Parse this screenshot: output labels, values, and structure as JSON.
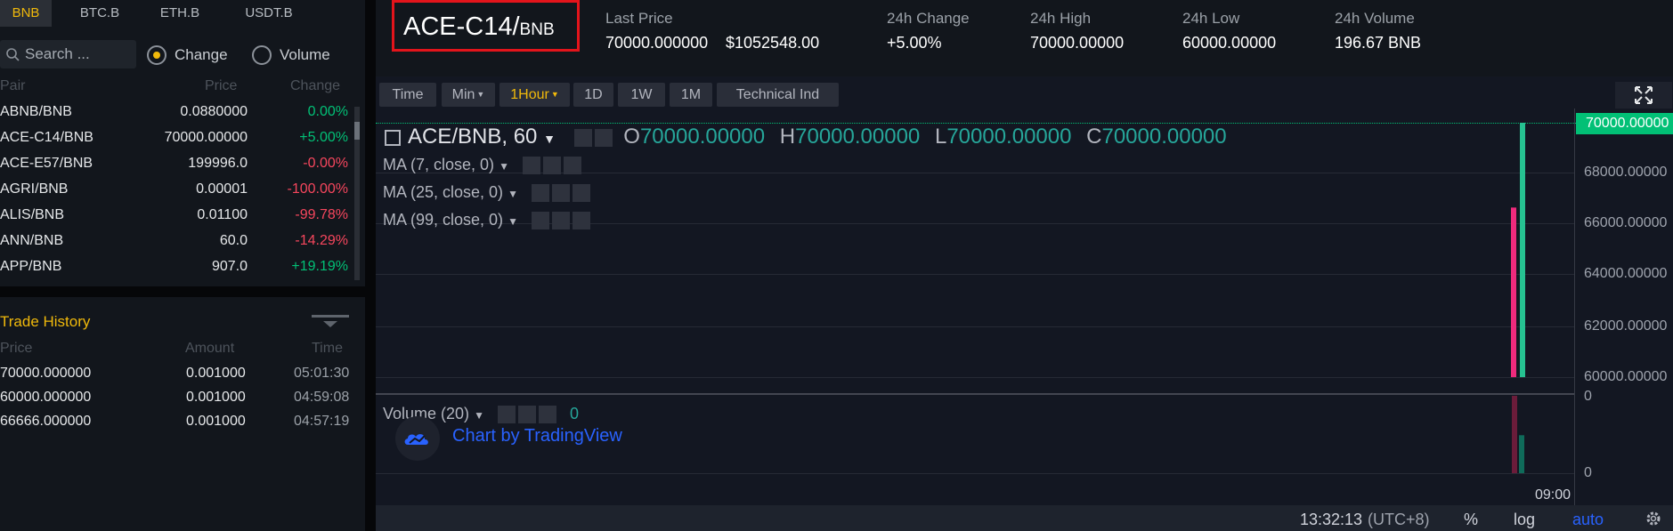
{
  "quote_tabs": [
    {
      "label": "BNB",
      "active": true
    },
    {
      "label": "BTC.B",
      "active": false
    },
    {
      "label": "ETH.B",
      "active": false
    },
    {
      "label": "USDT.B",
      "active": false
    }
  ],
  "search": {
    "placeholder": "Search ..."
  },
  "sort_options": [
    {
      "label": "Change",
      "checked": true
    },
    {
      "label": "Volume",
      "checked": false
    }
  ],
  "pair_table": {
    "headers": {
      "pair": "Pair",
      "price": "Price",
      "change": "Change"
    },
    "rows": [
      {
        "pair": "ABNB/BNB",
        "price": "0.0880000",
        "change": "0.00%",
        "dir": "up"
      },
      {
        "pair": "ACE-C14/BNB",
        "price": "70000.00000",
        "change": "+5.00%",
        "dir": "up"
      },
      {
        "pair": "ACE-E57/BNB",
        "price": "199996.0",
        "change": "-0.00%",
        "dir": "down"
      },
      {
        "pair": "AGRI/BNB",
        "price": "0.00001",
        "change": "-100.00%",
        "dir": "down"
      },
      {
        "pair": "ALIS/BNB",
        "price": "0.01100",
        "change": "-99.78%",
        "dir": "down"
      },
      {
        "pair": "ANN/BNB",
        "price": "60.0",
        "change": "-14.29%",
        "dir": "down"
      },
      {
        "pair": "APP/BNB",
        "price": "907.0",
        "change": "+19.19%",
        "dir": "up"
      }
    ]
  },
  "trade_history": {
    "title": "Trade History",
    "headers": {
      "price": "Price",
      "amount": "Amount",
      "time": "Time"
    },
    "rows": [
      {
        "price": "70000.000000",
        "amount": "0.001000",
        "time": "05:01:30"
      },
      {
        "price": "60000.000000",
        "amount": "0.001000",
        "time": "04:59:08"
      },
      {
        "price": "66666.000000",
        "amount": "0.001000",
        "time": "04:57:19"
      }
    ]
  },
  "header": {
    "symbol": "ACE-C14/",
    "symbol_quote": "BNB",
    "last_price_label": "Last Price",
    "last_price": "70000.000000",
    "last_price_usd": "$1052548.00",
    "change_label": "24h Change",
    "change": "+5.00%",
    "high_label": "24h High",
    "high": "70000.00000",
    "low_label": "24h Low",
    "low": "60000.00000",
    "volume_label": "24h Volume",
    "volume": "196.67 BNB"
  },
  "toolbar": {
    "buttons": [
      "Time",
      "Min",
      "1Hour",
      "1D",
      "1W",
      "1M",
      "Technical Ind"
    ],
    "active": "1Hour"
  },
  "chart": {
    "title": "ACE/BNB, 60",
    "ohlc": {
      "o_label": "O",
      "o": "70000.00000",
      "h_label": "H",
      "h": "70000.00000",
      "l_label": "L",
      "l": "70000.00000",
      "c_label": "C",
      "c": "70000.00000"
    },
    "studies": [
      "MA (7, close, 0)",
      "MA (25, close, 0)",
      "MA (99, close, 0)"
    ],
    "volume_label": "Volume (20)",
    "volume_value": "0",
    "watermark": "Chart by TradingView",
    "last_price_tag": "70000.00000",
    "price_ticks": [
      "68000.00000",
      "66000.00000",
      "64000.00000",
      "62000.00000",
      "60000.00000"
    ],
    "volume_ticks": [
      "0",
      "0"
    ],
    "time_tick": "09:00"
  },
  "chart_data": {
    "type": "candlestick",
    "candles": [
      {
        "open": 66666,
        "close": 60000,
        "dir": "down"
      },
      {
        "open": 60000,
        "close": 70000,
        "dir": "up"
      }
    ],
    "ylim": [
      59800,
      70200
    ],
    "volume": [
      {
        "value": 0.0053,
        "dir": "down"
      },
      {
        "value": 0.0026,
        "dir": "up"
      }
    ]
  },
  "footer": {
    "time": "13:32:13",
    "timezone": "(UTC+8)",
    "percent": "%",
    "log": "log",
    "auto": "auto"
  }
}
